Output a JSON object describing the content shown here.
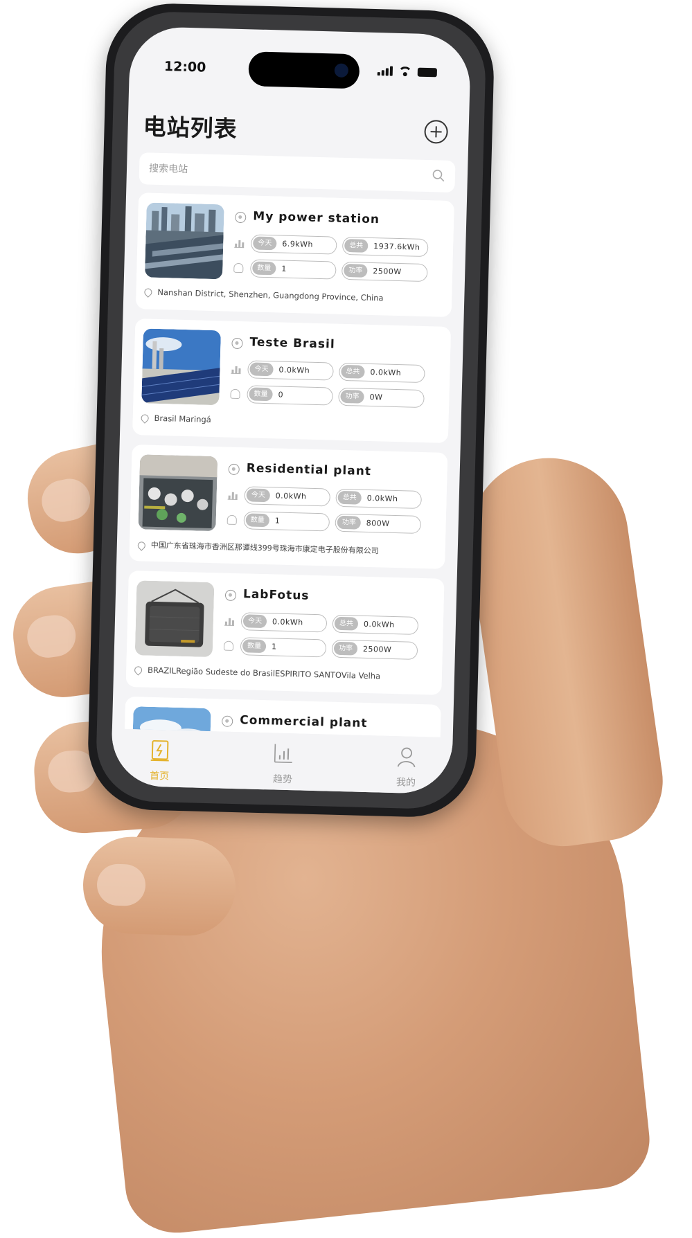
{
  "status_bar": {
    "time": "12:00"
  },
  "header": {
    "title": "电站列表"
  },
  "search": {
    "placeholder": "搜索电站"
  },
  "stations": [
    {
      "name": "My power station",
      "today_tag": "今天",
      "today": "6.9kWh",
      "total_tag": "总共",
      "total": "1937.6kWh",
      "count_tag": "数量",
      "count": "1",
      "power_tag": "功率",
      "power": "2500W",
      "address": "Nanshan District, Shenzhen, Guangdong Province, China"
    },
    {
      "name": "Teste Brasil",
      "today_tag": "今天",
      "today": "0.0kWh",
      "total_tag": "总共",
      "total": "0.0kWh",
      "count_tag": "数量",
      "count": "0",
      "power_tag": "功率",
      "power": "0W",
      "address": "Brasil Maringá"
    },
    {
      "name": "Residential plant",
      "today_tag": "今天",
      "today": "0.0kWh",
      "total_tag": "总共",
      "total": "0.0kWh",
      "count_tag": "数量",
      "count": "1",
      "power_tag": "功率",
      "power": "800W",
      "address": "中国广东省珠海市香洲区那谭线399号珠海市康定电子股份有限公司"
    },
    {
      "name": "LabFotus",
      "today_tag": "今天",
      "today": "0.0kWh",
      "total_tag": "总共",
      "total": "0.0kWh",
      "count_tag": "数量",
      "count": "1",
      "power_tag": "功率",
      "power": "2500W",
      "address": "BRAZILRegião Sudeste do BrasilESPIRITO SANTOVila Velha"
    },
    {
      "name": "Commercial plant"
    }
  ],
  "tabbar": {
    "home": "首页",
    "trend": "趋势",
    "mine": "我的"
  },
  "colors": {
    "accent": "#e4b22c",
    "tag_gray": "#bdbdbd",
    "background": "#f4f4f6"
  }
}
